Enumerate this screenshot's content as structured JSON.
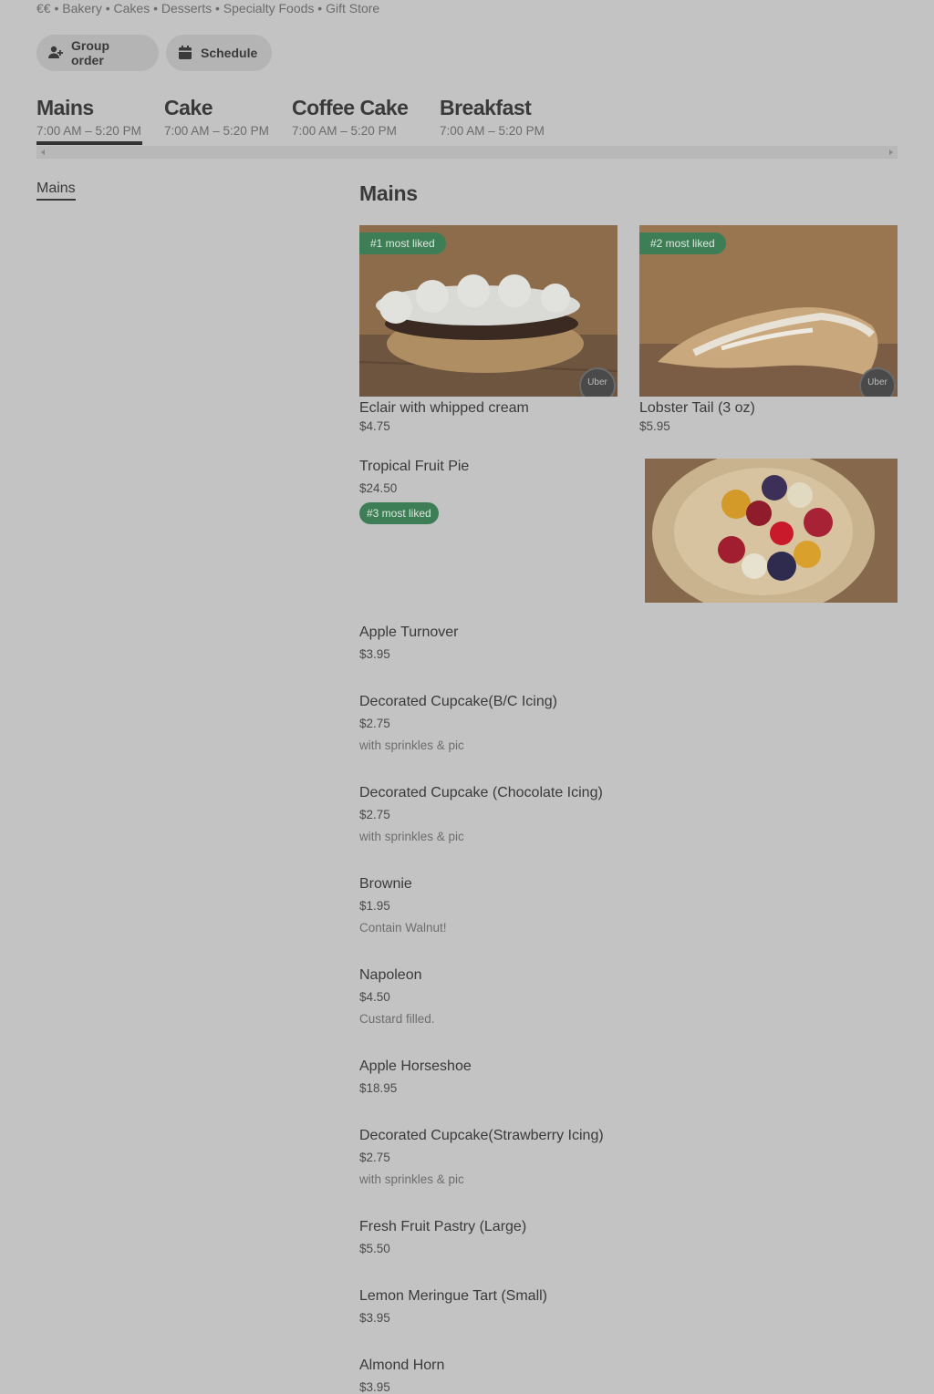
{
  "store": {
    "tags": "€€ • Bakery • Cakes • Desserts • Specialty Foods • Gift Store"
  },
  "actions": {
    "group_order": "Group order",
    "schedule": "Schedule"
  },
  "menus": [
    {
      "name": "Mains",
      "hours": "7:00 AM – 5:20 PM",
      "selected": true
    },
    {
      "name": "Cake",
      "hours": "7:00 AM – 5:20 PM"
    },
    {
      "name": "Coffee Cake",
      "hours": "7:00 AM – 5:20 PM"
    },
    {
      "name": "Breakfast",
      "hours": "7:00 AM – 5:20 PM"
    }
  ],
  "sidebar": {
    "items": [
      "Mains"
    ]
  },
  "section": {
    "title": "Mains"
  },
  "featured": [
    {
      "title": "Eclair with whipped cream",
      "price": "$4.75",
      "badge": "#1 most liked",
      "logo": "Uber"
    },
    {
      "title": "Lobster Tail (3 oz)",
      "price": "$5.95",
      "badge": "#2 most liked",
      "logo": "Uber"
    }
  ],
  "items": [
    {
      "title": "Tropical Fruit Pie",
      "price": "$24.50",
      "badge": "#3 most liked"
    },
    {
      "title": "Apple Turnover",
      "price": "$3.95"
    },
    {
      "title": "Decorated Cupcake(B/C Icing)",
      "price": "$2.75",
      "desc": "with sprinkles & pic"
    },
    {
      "title": "Decorated Cupcake (Chocolate Icing)",
      "price": "$2.75",
      "desc": "with sprinkles & pic"
    },
    {
      "title": "Brownie",
      "price": "$1.95",
      "desc": "Contain Walnut!"
    },
    {
      "title": "Napoleon",
      "price": "$4.50",
      "desc": "Custard filled."
    },
    {
      "title": "Apple Horseshoe",
      "price": "$18.95"
    },
    {
      "title": "Decorated Cupcake(Strawberry Icing)",
      "price": "$2.75",
      "desc": "with sprinkles & pic"
    },
    {
      "title": "Fresh Fruit Pastry (Large)",
      "price": "$5.50"
    },
    {
      "title": "Lemon Meringue Tart (Small)",
      "price": "$3.95"
    },
    {
      "title": "Almond Horn",
      "price": "$3.95"
    }
  ],
  "colors": {
    "overlay_bg": "#c3c3c3",
    "badge_green": "#3e7e57"
  }
}
